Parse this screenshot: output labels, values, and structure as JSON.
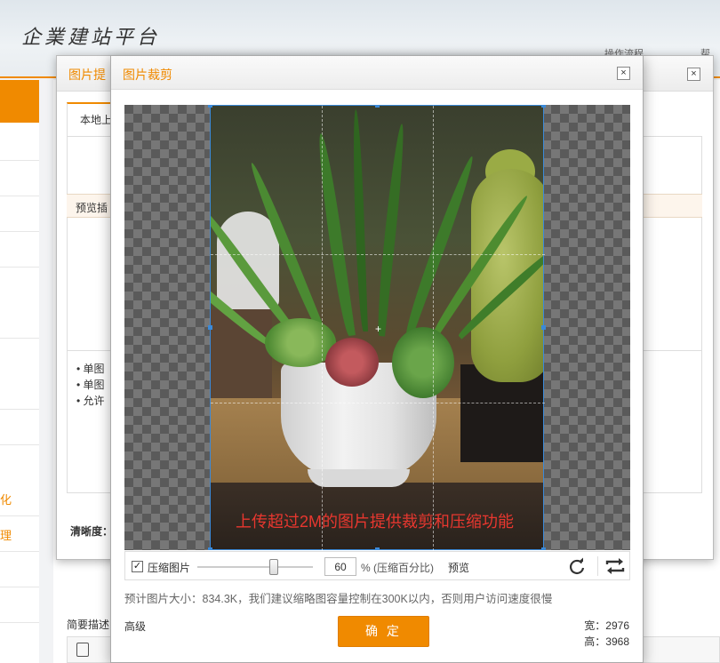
{
  "app": {
    "logo_text": "企業建站平台",
    "header_links": [
      "操作流程",
      "帮"
    ]
  },
  "background": {
    "sidebar_fragments": [
      "化",
      "理"
    ],
    "desc_label": "简要描述"
  },
  "upload_dialog": {
    "title": "图片提",
    "tab_local": "本地上",
    "preview_header": "预览插",
    "notes": [
      "单图",
      "单图",
      "允许"
    ],
    "clarity_label": "清晰度："
  },
  "crop_dialog": {
    "title": "图片裁剪",
    "close_symbol": "×",
    "crop_caption": "上传超过2M的图片提供裁剪和压缩功能",
    "compress_checked": true,
    "compress_label": "压缩图片",
    "compress_value": "60",
    "percent_label": "% (压缩百分比)",
    "preview_label": "预览",
    "compress_fraction": 0.6,
    "size_note": "预计图片大小：834.3K，我们建议缩略图容量控制在300K以内，否则用户访问速度很慢",
    "advanced_label": "高级",
    "confirm_label": "确 定",
    "width_label": "宽：2976",
    "height_label": "高：3968"
  },
  "colors": {
    "accent": "#f08a00",
    "crop_border": "#3b8ad9",
    "caption_red": "#e8372f"
  },
  "icons": [
    "close-icon",
    "rotate-icon",
    "flip-icon",
    "checkbox-check-icon",
    "document-icon"
  ]
}
